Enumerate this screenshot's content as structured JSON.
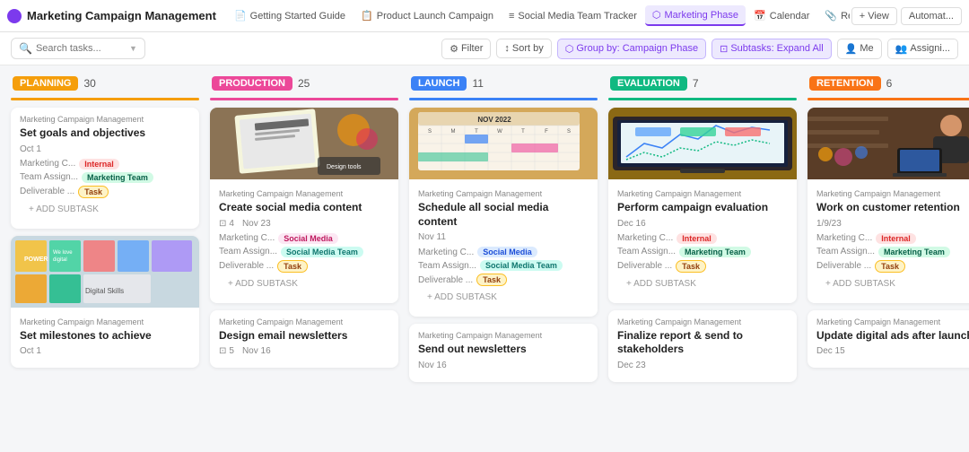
{
  "nav": {
    "logo": "⚙",
    "title": "Marketing Campaign Management",
    "tabs": [
      {
        "label": "Getting Started Guide",
        "icon": "📄",
        "active": false
      },
      {
        "label": "Product Launch Campaign",
        "icon": "📋",
        "active": false
      },
      {
        "label": "Social Media Team Tracker",
        "icon": "≡",
        "active": false
      },
      {
        "label": "Marketing Phase",
        "icon": "⬡",
        "active": true
      },
      {
        "label": "Calendar",
        "icon": "📅",
        "active": false
      },
      {
        "label": "Ref.",
        "icon": "📎",
        "active": false
      }
    ],
    "actions": [
      {
        "label": "+ View"
      },
      {
        "label": "Automat..."
      }
    ]
  },
  "toolbar": {
    "search_placeholder": "Search tasks...",
    "filter_label": "Filter",
    "sort_label": "Sort by",
    "group_label": "Group by: Campaign Phase",
    "subtasks_label": "Subtasks: Expand All",
    "me_label": "Me",
    "assignee_label": "Assigni..."
  },
  "columns": [
    {
      "id": "planning",
      "phase": "PLANNING",
      "count": "30",
      "color": "#f59e0b",
      "line_color": "#f59e0b",
      "cards": [
        {
          "id": "p1",
          "meta": "Marketing Campaign Management",
          "title": "Set goals and objectives",
          "date": "Oct 1",
          "marketing_c": "Marketing C...",
          "tag1_label": "Internal",
          "tag1_class": "tag-internal",
          "team_assign": "Team Assign...",
          "tag2_label": "Marketing Team",
          "tag2_class": "tag-marketing",
          "deliverable": "Deliverable ...",
          "tag3_label": "Task",
          "tag3_class": "tag-task",
          "has_add_subtask": true,
          "has_image": false
        },
        {
          "id": "p2",
          "meta": "Marketing Campaign Management",
          "title": "Set milestones to achieve",
          "date": "Oct 1",
          "has_image": true,
          "image_type": "sticky-notes",
          "has_add_subtask": false,
          "marketing_c": "",
          "tag1_label": "",
          "team_assign": "",
          "tag2_label": "",
          "deliverable": "",
          "tag3_label": ""
        }
      ]
    },
    {
      "id": "production",
      "phase": "PRODUCTION",
      "count": "25",
      "color": "#ec4899",
      "line_color": "#ec4899",
      "cards": [
        {
          "id": "pr1",
          "meta": "Marketing Campaign Management",
          "title": "Create social media content",
          "date": "Nov 23",
          "subtask_count": "4",
          "marketing_c": "Marketing C...",
          "tag1_label": "Social Media",
          "tag1_class": "tag-pink",
          "team_assign": "Team Assign...",
          "tag2_label": "Social Media Team",
          "tag2_class": "tag-teal",
          "deliverable": "Deliverable ...",
          "tag3_label": "Task",
          "tag3_class": "tag-task",
          "has_add_subtask": true,
          "has_image": true,
          "image_type": "design-work"
        },
        {
          "id": "pr2",
          "meta": "Marketing Campaign Management",
          "title": "Design email newsletters",
          "date": "Nov 16",
          "subtask_count": "5",
          "has_image": false,
          "has_add_subtask": false,
          "marketing_c": "",
          "tag1_label": "",
          "team_assign": "",
          "tag2_label": "",
          "deliverable": "",
          "tag3_label": ""
        }
      ]
    },
    {
      "id": "launch",
      "phase": "LAUNCH",
      "count": "11",
      "color": "#3b82f6",
      "line_color": "#3b82f6",
      "cards": [
        {
          "id": "l1",
          "meta": "Marketing Campaign Management",
          "title": "Schedule all social media content",
          "date": "Nov 11",
          "marketing_c": "Marketing C...",
          "tag1_label": "Social Media",
          "tag1_class": "tag-blue",
          "team_assign": "Team Assign...",
          "tag2_label": "Social Media Team",
          "tag2_class": "tag-teal",
          "deliverable": "Deliverable ...",
          "tag3_label": "Task",
          "tag3_class": "tag-task",
          "has_add_subtask": true,
          "has_image": true,
          "image_type": "calendar-grid"
        },
        {
          "id": "l2",
          "meta": "Marketing Campaign Management",
          "title": "Send out newsletters",
          "date": "Nov 16",
          "has_image": false,
          "has_add_subtask": false,
          "marketing_c": "",
          "tag1_label": "",
          "team_assign": "",
          "tag2_label": "",
          "deliverable": "",
          "tag3_label": ""
        }
      ]
    },
    {
      "id": "evaluation",
      "phase": "EVALUATION",
      "count": "7",
      "color": "#10b981",
      "line_color": "#10b981",
      "cards": [
        {
          "id": "e1",
          "meta": "Marketing Campaign Management",
          "title": "Perform campaign evaluation",
          "date": "Dec 16",
          "marketing_c": "Marketing C...",
          "tag1_label": "Internal",
          "tag1_class": "tag-internal",
          "team_assign": "Team Assign...",
          "tag2_label": "Marketing Team",
          "tag2_class": "tag-marketing",
          "deliverable": "Deliverable ...",
          "tag3_label": "Task",
          "tag3_class": "tag-task",
          "has_add_subtask": true,
          "has_image": true,
          "image_type": "laptop-charts"
        },
        {
          "id": "e2",
          "meta": "Marketing Campaign Management",
          "title": "Finalize report & send to stakeholders",
          "date": "Dec 23",
          "has_image": false,
          "has_add_subtask": false,
          "marketing_c": "",
          "tag1_label": "",
          "team_assign": "",
          "tag2_label": "",
          "deliverable": "",
          "tag3_label": ""
        }
      ]
    },
    {
      "id": "retention",
      "phase": "RETENTION",
      "count": "6",
      "color": "#f97316",
      "line_color": "#f97316",
      "cards": [
        {
          "id": "r1",
          "meta": "Marketing Campaign Management",
          "title": "Work on customer retention",
          "date": "1/9/23",
          "marketing_c": "Marketing C...",
          "tag1_label": "Internal",
          "tag1_class": "tag-internal",
          "team_assign": "Team Assign...",
          "tag2_label": "Marketing Team",
          "tag2_class": "tag-marketing",
          "deliverable": "Deliverable ...",
          "tag3_label": "Task",
          "tag3_class": "tag-task",
          "has_add_subtask": true,
          "has_image": true,
          "image_type": "person-laptop"
        },
        {
          "id": "r2",
          "meta": "Marketing Campaign Management",
          "title": "Update digital ads after launch",
          "date": "Dec 15",
          "has_image": false,
          "has_add_subtask": false,
          "marketing_c": "",
          "tag1_label": "",
          "team_assign": "",
          "tag2_label": "",
          "deliverable": "",
          "tag3_label": ""
        }
      ]
    }
  ]
}
